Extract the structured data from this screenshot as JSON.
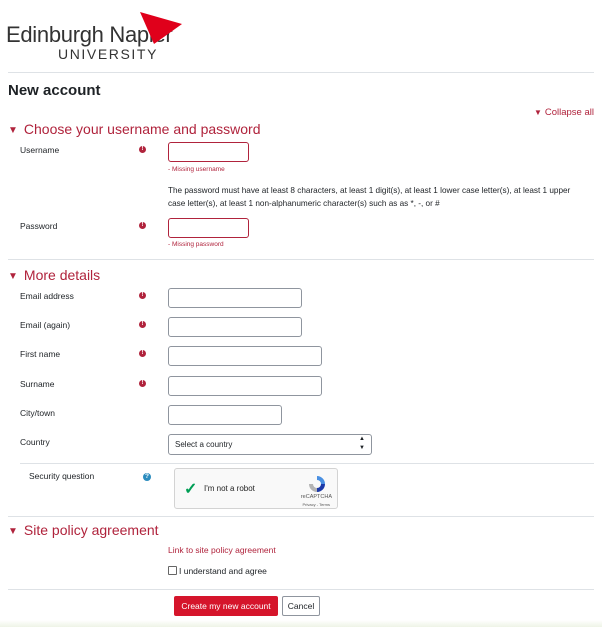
{
  "brand": {
    "name_line1": "Edinburgh Napier",
    "name_line2": "UNIVERSITY",
    "color": "#e0001b"
  },
  "page_title": "New account",
  "collapse_all": "Collapse all",
  "accent_color": "#b0233c",
  "sections": {
    "credentials": {
      "title": "Choose your username and password",
      "username_label": "Username",
      "username_error": "- Missing username",
      "password_note": "The password must have at least 8 characters, at least 1 digit(s), at least 1 lower case letter(s), at least 1 upper case letter(s), at least 1 non-alphanumeric character(s) such as as *, -, or #",
      "password_label": "Password",
      "password_error": "- Missing password"
    },
    "details": {
      "title": "More details",
      "email_label": "Email address",
      "email_again_label": "Email (again)",
      "first_name_label": "First name",
      "surname_label": "Surname",
      "city_label": "City/town",
      "country_label": "Country",
      "country_selected": "Select a country",
      "security_label": "Security question",
      "recaptcha": {
        "label": "I'm not a robot",
        "brand": "reCAPTCHA",
        "terms": "Privacy - Terms"
      }
    },
    "policy": {
      "title": "Site policy agreement",
      "link": "Link to site policy agreement",
      "agree_label": "I understand and agree"
    }
  },
  "buttons": {
    "create": "Create my new account",
    "cancel": "Cancel"
  },
  "icons": {
    "required": "exclamation-circle-icon",
    "help": "question-circle-icon",
    "collapse": "caret-down-icon"
  }
}
